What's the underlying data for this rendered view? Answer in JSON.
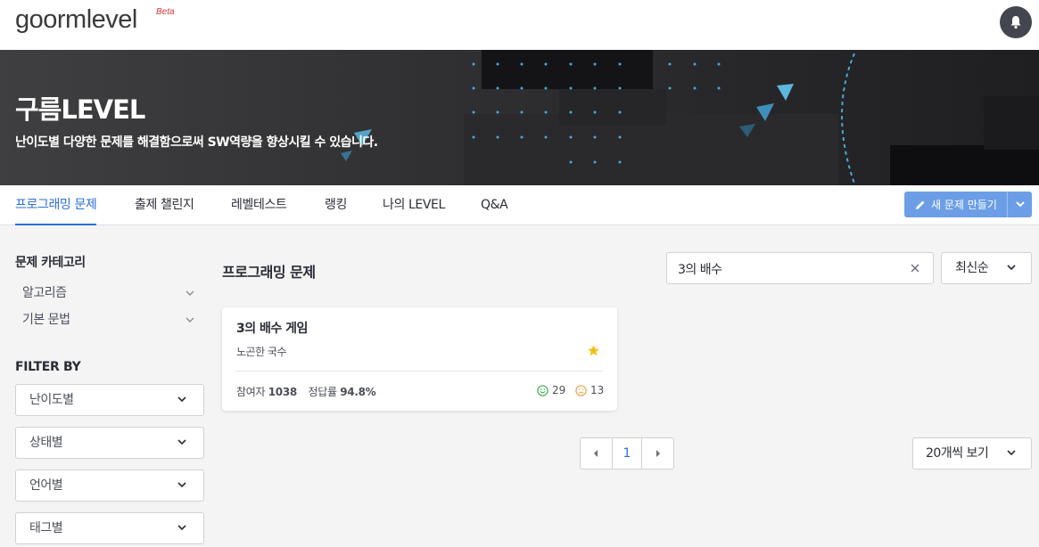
{
  "header": {
    "logo": "goormlevel",
    "logo_badge": "Beta",
    "bell_icon": "bell-icon"
  },
  "hero": {
    "title": "구름LEVEL",
    "subtitle": "난이도별 다양한 문제를 해결함으로써 SW역량을 향상시킬 수 있습니다."
  },
  "nav": {
    "tabs": [
      {
        "label": "프로그래밍 문제",
        "active": true
      },
      {
        "label": "출제 챌린지"
      },
      {
        "label": "레벨테스트"
      },
      {
        "label": "랭킹"
      },
      {
        "label": "나의 LEVEL"
      },
      {
        "label": "Q&A"
      }
    ],
    "new_button": "새 문제 만들기",
    "new_button_icon": "pencil-icon"
  },
  "sidebar": {
    "category_title": "문제 카테고리",
    "categories": [
      {
        "label": "알고리즘"
      },
      {
        "label": "기본 문법"
      }
    ],
    "filter_title": "FILTER BY",
    "filters": [
      {
        "label": "난이도별"
      },
      {
        "label": "상태별"
      },
      {
        "label": "언어별"
      },
      {
        "label": "태그별"
      }
    ]
  },
  "main": {
    "title": "프로그래밍 문제",
    "search": {
      "value": "3의 배수",
      "placeholder": ""
    },
    "sort_label": "최신순"
  },
  "problems": [
    {
      "title": "3의 배수 게임",
      "author": "노곤한 국수",
      "starred": true,
      "participants_label": "참여자",
      "participants": "1038",
      "accuracy_label": "정답률",
      "accuracy": "94.8%",
      "likes": "29",
      "dislikes": "13"
    }
  ],
  "pagination": {
    "current_page": "1",
    "per_page_label": "20개씩 보기"
  },
  "colors": {
    "accent": "#2a6fd6",
    "button": "#6b9ee6",
    "star": "#f2c01a",
    "like": "#3fb34f",
    "dislike": "#f0a04a"
  }
}
